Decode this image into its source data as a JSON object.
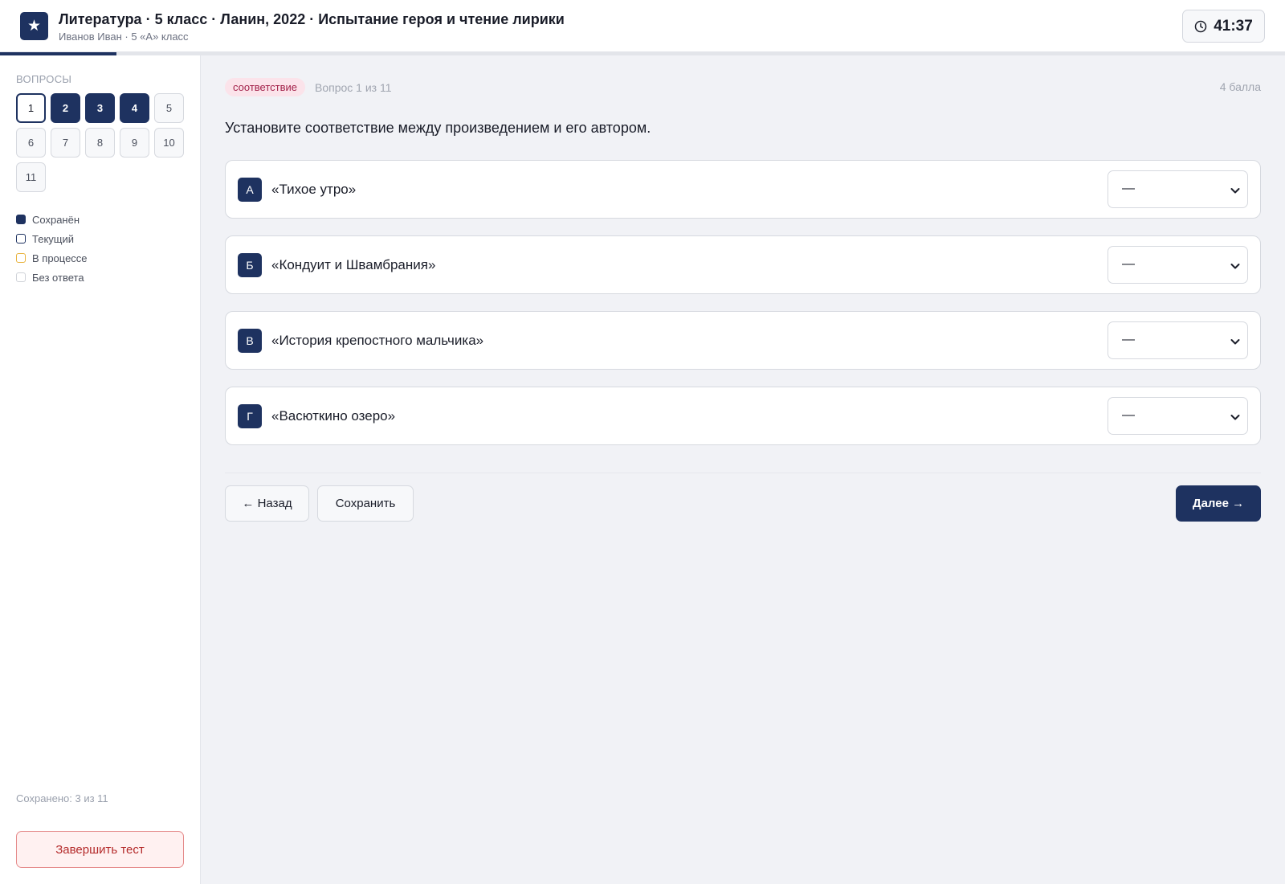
{
  "header": {
    "logo_icon": "star-icon",
    "logo_glyph": "★",
    "title": "Литература · 5 класс · Ланин, 2022 · Испытание героя и чтение лирики",
    "subtitle": "Иванов Иван · 5 «А» класс",
    "timer_icon": "clock-icon",
    "timer": "41:37",
    "progress_fraction": 0.0909
  },
  "sidebar": {
    "heading": "ВОПРОСЫ",
    "questions": [
      {
        "num": "1",
        "state": "current"
      },
      {
        "num": "2",
        "state": "saved"
      },
      {
        "num": "3",
        "state": "saved"
      },
      {
        "num": "4",
        "state": "saved"
      },
      {
        "num": "5",
        "state": "none"
      },
      {
        "num": "6",
        "state": "none"
      },
      {
        "num": "7",
        "state": "none"
      },
      {
        "num": "8",
        "state": "none"
      },
      {
        "num": "9",
        "state": "none"
      },
      {
        "num": "10",
        "state": "none"
      },
      {
        "num": "11",
        "state": "none"
      }
    ],
    "legend": [
      {
        "label": "Сохранён",
        "state": "saved"
      },
      {
        "label": "Текущий",
        "state": "current"
      },
      {
        "label": "В процессе",
        "state": "progress"
      },
      {
        "label": "Без ответа",
        "state": "none"
      }
    ],
    "saved_count": "Сохранено: 3 из 11",
    "finish_label": "Завершить тест"
  },
  "main": {
    "type_badge": "соответствие",
    "counter": "Вопрос 1 из 11",
    "points": "4 балла",
    "question_text": "Установите соответствие между произведением и его автором.",
    "items": [
      {
        "letter": "А",
        "text": "«Тихое утро»",
        "selected": "—"
      },
      {
        "letter": "Б",
        "text": "«Кондуит и Швамбрания»",
        "selected": "—"
      },
      {
        "letter": "В",
        "text": "«История крепостного мальчика»",
        "selected": "—"
      },
      {
        "letter": "Г",
        "text": "«Васюткино озеро»",
        "selected": "—"
      }
    ],
    "back_label": "← Назад",
    "save_label": "Сохранить",
    "next_label": "Далее →"
  },
  "colors": {
    "accent": "#1e3260",
    "badge_bg": "#fbe3ea",
    "badge_text": "#a3224a",
    "danger": "#b42a2a",
    "in_progress": "#e8b23b"
  }
}
